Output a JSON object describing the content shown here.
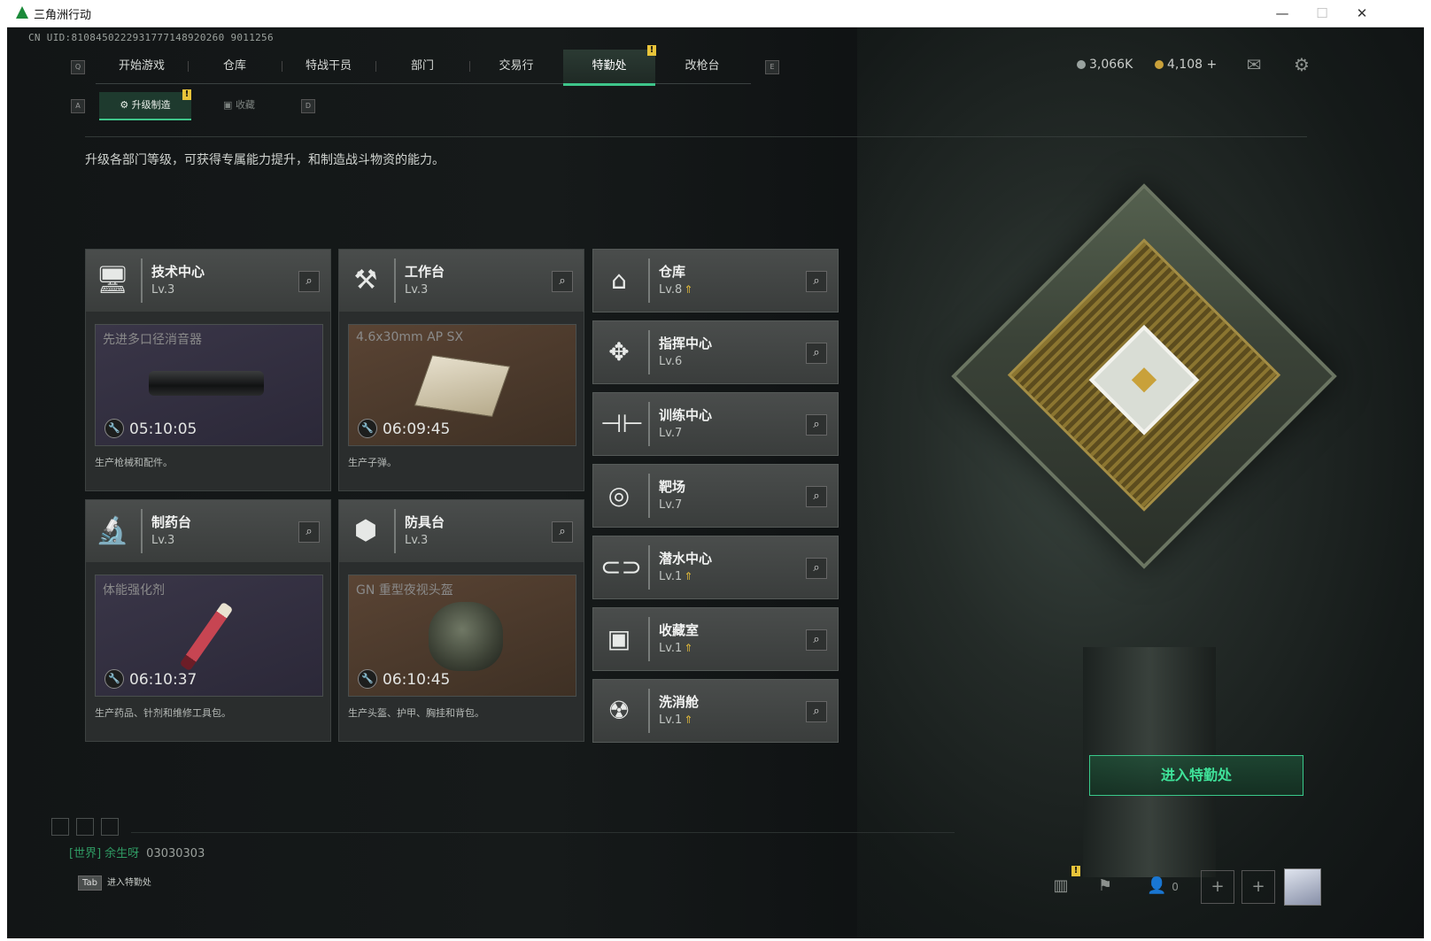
{
  "window": {
    "title": "三角洲行动",
    "minimize": "—",
    "maximize": "☐",
    "close": "✕"
  },
  "uid": "CN UID:8108450222931777148920260 9011256",
  "nav": {
    "keys": {
      "left": "Q",
      "right": "E"
    },
    "tabs": [
      "开始游戏",
      "仓库",
      "特战干员",
      "部门",
      "交易行",
      "特勤处",
      "改枪台"
    ],
    "active": "特勤处"
  },
  "currency": {
    "a": "3,066K",
    "b": "4,108",
    "b_plus": "+"
  },
  "subnav": {
    "keys": {
      "left": "A",
      "right": "D"
    },
    "active": "升级制造",
    "inactive": "收藏"
  },
  "description": "升级各部门等级，可获得专属能力提升，和制造战斗物资的能力。",
  "production_cards": [
    {
      "name": "技术中心",
      "level": "Lv.3",
      "item": "先进多口径消音器",
      "timer": "05:10:05",
      "desc": "生产枪械和配件。"
    },
    {
      "name": "工作台",
      "level": "Lv.3",
      "item": "4.6x30mm AP SX",
      "timer": "06:09:45",
      "desc": "生产子弹。"
    },
    {
      "name": "制药台",
      "level": "Lv.3",
      "item": "体能强化剂",
      "timer": "06:10:37",
      "desc": "生产药品、针剂和维修工具包。"
    },
    {
      "name": "防具台",
      "level": "Lv.3",
      "item": "GN 重型夜视头盔",
      "timer": "06:10:45",
      "desc": "生产头盔、护甲、胸挂和背包。"
    }
  ],
  "side_cards": [
    {
      "name": "仓库",
      "level": "Lv.8",
      "upgrade": true
    },
    {
      "name": "指挥中心",
      "level": "Lv.6",
      "upgrade": false
    },
    {
      "name": "训练中心",
      "level": "Lv.7",
      "upgrade": false
    },
    {
      "name": "靶场",
      "level": "Lv.7",
      "upgrade": false
    },
    {
      "name": "潜水中心",
      "level": "Lv.1",
      "upgrade": true
    },
    {
      "name": "收藏室",
      "level": "Lv.1",
      "upgrade": true
    },
    {
      "name": "洗消舱",
      "level": "Lv.1",
      "upgrade": true
    }
  ],
  "enter_button": "进入特勤处",
  "chat": {
    "channel": "[世界]",
    "user": "余生呀",
    "message": "03030303"
  },
  "tab_hint": {
    "key": "Tab",
    "label": "进入特勤处"
  },
  "bottom": {
    "friends_count": "0"
  },
  "warning_mark": "!",
  "colors": {
    "accent": "#3ec58a",
    "upgrade": "#e0b83a",
    "warning": "#e8c43a"
  }
}
